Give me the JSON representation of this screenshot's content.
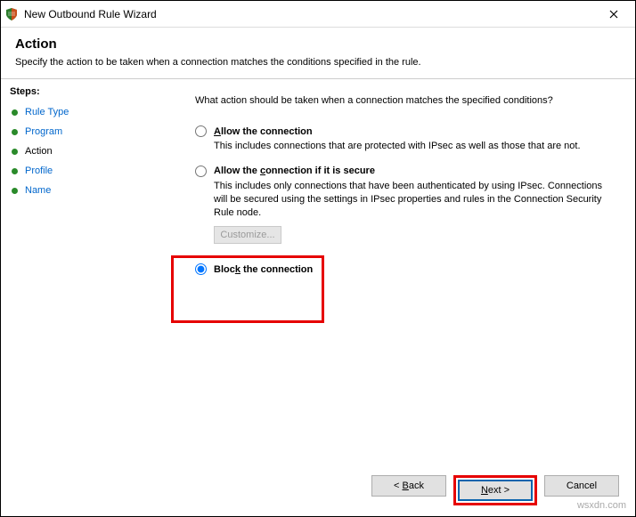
{
  "title": "New Outbound Rule Wizard",
  "header": {
    "title": "Action",
    "subtitle": "Specify the action to be taken when a connection matches the conditions specified in the rule."
  },
  "sidebar": {
    "label": "Steps:",
    "items": [
      {
        "label": "Rule Type"
      },
      {
        "label": "Program"
      },
      {
        "label": "Action"
      },
      {
        "label": "Profile"
      },
      {
        "label": "Name"
      }
    ]
  },
  "content": {
    "question": "What action should be taken when a connection matches the specified conditions?",
    "opt1": {
      "prefix": "A",
      "rest": "llow the connection",
      "desc": "This includes connections that are protected with IPsec as well as those that are not."
    },
    "opt2": {
      "prefix": "Allow the ",
      "u": "c",
      "rest": "onnection if it is secure",
      "desc": "This includes only connections that have been authenticated by using IPsec. Connections will be secured using the settings in IPsec properties and rules in the Connection Security Rule node."
    },
    "customize": "Customize...",
    "opt3": {
      "prefix": "Bloc",
      "u": "k",
      "rest": " the connection"
    }
  },
  "footer": {
    "back_pre": "< ",
    "back_u": "B",
    "back_rest": "ack",
    "next_u": "N",
    "next_rest": "ext >",
    "cancel": "Cancel"
  },
  "watermark": "wsxdn.com"
}
